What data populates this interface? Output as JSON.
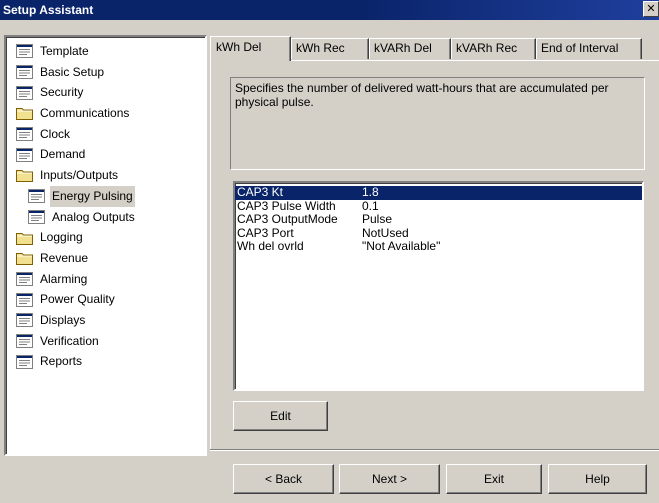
{
  "window": {
    "title": "Setup Assistant",
    "close_glyph": "✕"
  },
  "tree": {
    "items": [
      {
        "label": "Template",
        "icon": "document-icon",
        "level": 1
      },
      {
        "label": "Basic Setup",
        "icon": "document-icon",
        "level": 1
      },
      {
        "label": "Security",
        "icon": "document-icon",
        "level": 1
      },
      {
        "label": "Communications",
        "icon": "folder-icon",
        "level": 1
      },
      {
        "label": "Clock",
        "icon": "document-icon",
        "level": 1
      },
      {
        "label": "Demand",
        "icon": "document-icon",
        "level": 1
      },
      {
        "label": "Inputs/Outputs",
        "icon": "folder-icon",
        "level": 1
      },
      {
        "label": "Energy Pulsing",
        "icon": "document-icon",
        "level": 2,
        "selected": true
      },
      {
        "label": "Analog Outputs",
        "icon": "document-icon",
        "level": 2
      },
      {
        "label": "Logging",
        "icon": "folder-icon",
        "level": 1
      },
      {
        "label": "Revenue",
        "icon": "folder-icon",
        "level": 1
      },
      {
        "label": "Alarming",
        "icon": "document-icon",
        "level": 1
      },
      {
        "label": "Power Quality",
        "icon": "document-icon",
        "level": 1
      },
      {
        "label": "Displays",
        "icon": "document-icon",
        "level": 1
      },
      {
        "label": "Verification",
        "icon": "document-icon",
        "level": 1
      },
      {
        "label": "Reports",
        "icon": "document-icon",
        "level": 1
      }
    ]
  },
  "tabs": [
    {
      "label": "kWh Del",
      "active": true
    },
    {
      "label": "kWh Rec"
    },
    {
      "label": "kVARh Del"
    },
    {
      "label": "kVARh Rec"
    },
    {
      "label": "End of Interval"
    }
  ],
  "description": "Specifies the number of delivered watt-hours that are accumulated per physical pulse.",
  "properties": [
    {
      "name": "CAP3 Kt",
      "value": "1.8",
      "selected": true
    },
    {
      "name": "CAP3 Pulse Width",
      "value": "0.1"
    },
    {
      "name": "CAP3 OutputMode",
      "value": "Pulse"
    },
    {
      "name": "CAP3 Port",
      "value": "NotUsed"
    },
    {
      "name": "Wh del ovrld",
      "value": "\"Not Available\""
    }
  ],
  "buttons": {
    "edit": "Edit",
    "back": "< Back",
    "next": "Next >",
    "exit": "Exit",
    "help": "Help"
  },
  "colors": {
    "titlebar": "#0a246a",
    "selection": "#0a246a",
    "face": "#d4d0c8"
  }
}
